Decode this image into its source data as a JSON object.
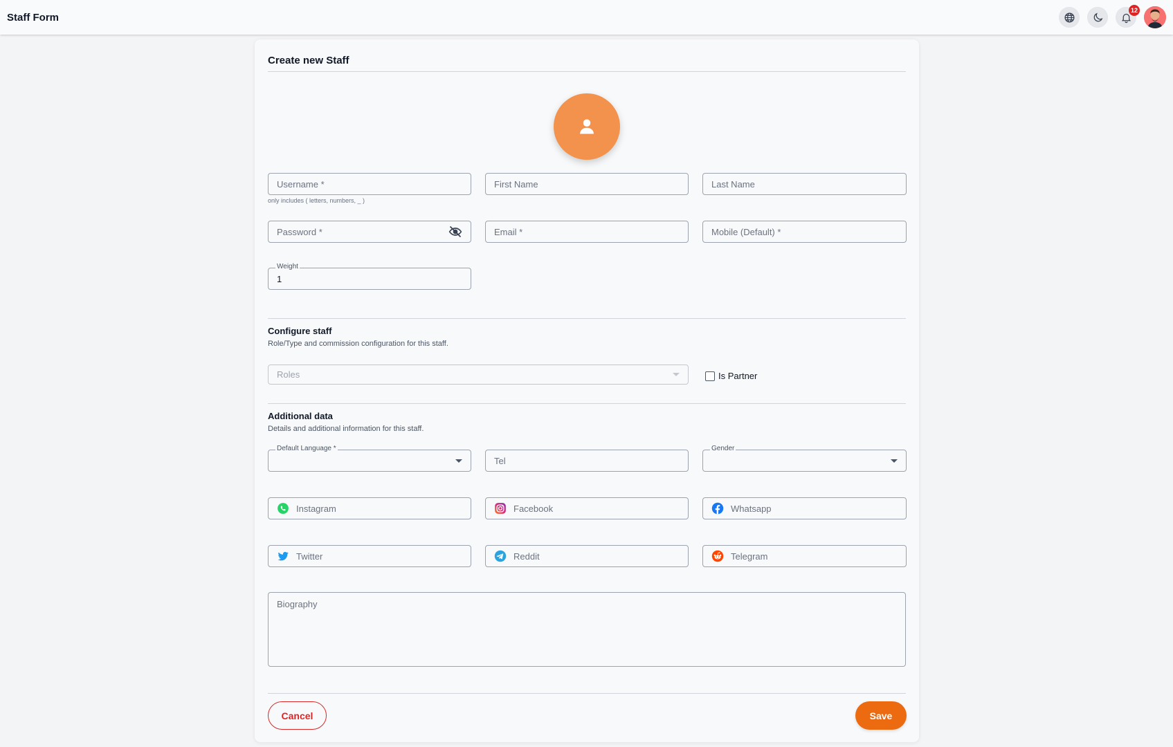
{
  "header": {
    "title": "Staff Form",
    "notification_count": "12"
  },
  "card": {
    "title": "Create new Staff"
  },
  "fields": {
    "username": {
      "placeholder": "Username *",
      "hint": "only includes ( letters, numbers, _ )"
    },
    "first_name": {
      "placeholder": "First Name"
    },
    "last_name": {
      "placeholder": "Last Name"
    },
    "password": {
      "placeholder": "Password *"
    },
    "email": {
      "placeholder": "Email *"
    },
    "mobile": {
      "placeholder": "Mobile (Default) *"
    },
    "weight": {
      "label": "Weight",
      "value": "1"
    }
  },
  "configure": {
    "title": "Configure staff",
    "description": "Role/Type and commission configuration for this staff.",
    "roles_placeholder": "Roles",
    "is_partner_label": "Is Partner"
  },
  "additional": {
    "title": "Additional data",
    "description": "Details and additional information for this staff.",
    "default_language_label": "Default Language *",
    "tel_placeholder": "Tel",
    "gender_label": "Gender",
    "social": [
      {
        "label": "Instagram",
        "icon": "whatsapp-icon"
      },
      {
        "label": "Facebook",
        "icon": "instagram-icon"
      },
      {
        "label": "Whatsapp",
        "icon": "facebook-icon"
      },
      {
        "label": "Twitter",
        "icon": "twitter-icon"
      },
      {
        "label": "Reddit",
        "icon": "telegram-icon"
      },
      {
        "label": "Telegram",
        "icon": "reddit-icon"
      }
    ],
    "biography_placeholder": "Biography"
  },
  "actions": {
    "cancel_label": "Cancel",
    "save_label": "Save"
  },
  "colors": {
    "accent": "#ec6a10",
    "avatar": "#f2924d",
    "danger": "#dc2626"
  }
}
